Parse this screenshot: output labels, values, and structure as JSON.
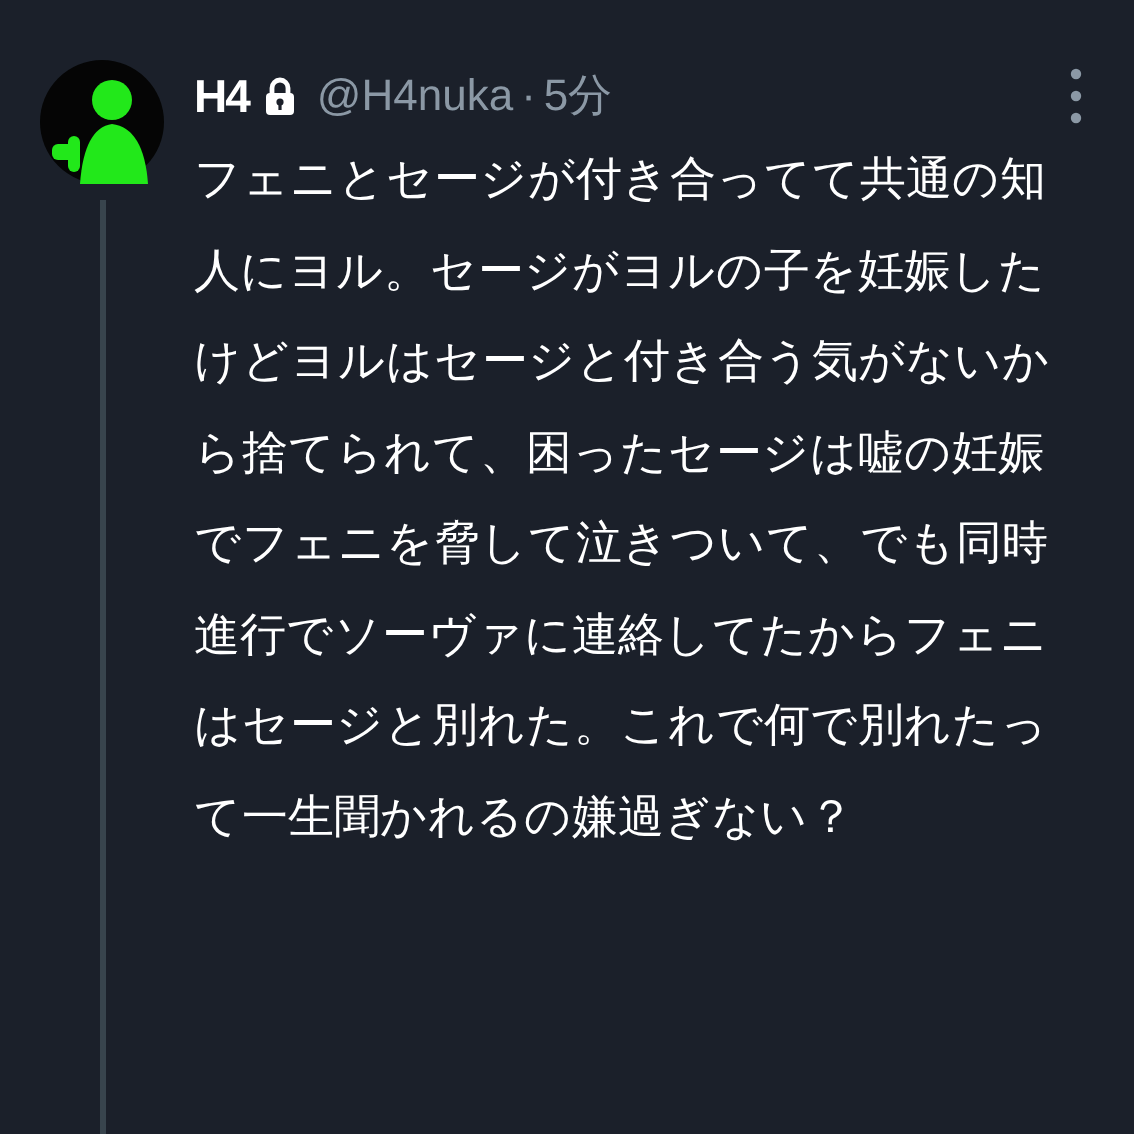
{
  "tweet": {
    "author": {
      "name": "H4",
      "protected": true,
      "handle": "@H4nuka",
      "separator": "·",
      "time": "5分"
    },
    "text": "フェニとセージが付き合ってて共通の知人にヨル。セージがヨルの子を妊娠したけどヨルはセージと付き合う気がないから捨てられて、困ったセージは嘘の妊娠でフェニを脅して泣きついて、でも同時進行でソーヴァに連絡してたからフェニはセージと別れた。これで何で別れたって一生聞かれるの嫌過ぎない？"
  }
}
